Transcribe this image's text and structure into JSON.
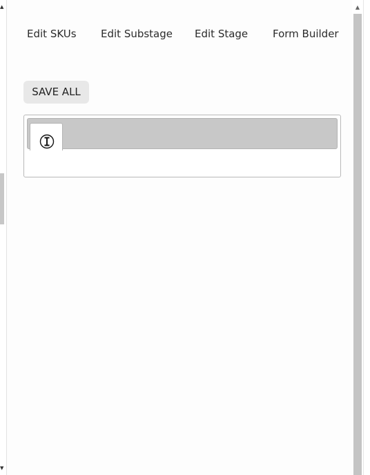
{
  "nav": {
    "links": [
      "Edit SKUs",
      "Edit Substage",
      "Edit Stage",
      "Form Builder"
    ]
  },
  "toolbar": {
    "save_all_label": "SAVE ALL"
  },
  "tabs": {
    "items": [
      {
        "icon": "text-cursor-icon",
        "active": true
      }
    ]
  },
  "scrollbars": {
    "outer_up": "▲",
    "outer_down": "▼",
    "inner_up": "▲"
  },
  "colors": {
    "tab_header": "#c8c8c8",
    "button_bg": "#e8e8e8",
    "scroll_track": "#c4c4c4"
  }
}
